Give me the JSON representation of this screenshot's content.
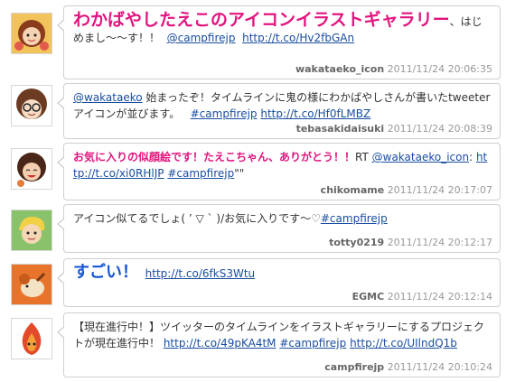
{
  "tweets": [
    {
      "avatar": "girl-with-bow-avatar",
      "lead": "わかばやしたえこのアイコンイラストギャラリー",
      "rest": "、はじめまし〜〜す！！ ",
      "links": [
        "@campfirejp",
        "http://t.co/Hv2fbGAn"
      ],
      "user": "wakataeko_icon",
      "time": "2011/11/24 20:06:35"
    },
    {
      "avatar": "glasses-girl-avatar",
      "mention": "@wakataeko",
      "text": " 始まったぞ！タイムラインに鬼の様にわかばやしさんが書いたtweeterアイコンが並びます。",
      "links": [
        "#campfirejp",
        "http://t.co/Hf0fLMBZ"
      ],
      "user": "tebasakidaisuki",
      "time": "2011/11/24 20:08:39"
    },
    {
      "avatar": "smiling-girl-avatar",
      "pink_text": "お気に入りの似顔絵です！たえこちゃん、ありがとう！！",
      "rt": "RT ",
      "mention": "@wakataeko_icon",
      "colon": ": ",
      "links": [
        "http://t.co/xi0RHlJP",
        "#campfirejp"
      ],
      "tail": "\"\"",
      "user": "chikomame",
      "time": "2011/11/24 20:17:07"
    },
    {
      "avatar": "blond-man-avatar",
      "text": "アイコン似てるでしょ( ’ ▽ ` )/お気に入りです〜♡",
      "links": [
        "#campfirejp"
      ],
      "user": "totty0219",
      "time": "2011/11/24 20:12:17"
    },
    {
      "avatar": "animal-avatar",
      "lead": "すごい！",
      "links": [
        "http://t.co/6fkS3Wtu"
      ],
      "user": "EGMC",
      "time": "2011/11/24 20:12:14"
    },
    {
      "avatar": "campfire-avatar",
      "text": "【現在進行中！】ツイッターのタイムラインをイラストギャラリーにするプロジェクトが現在進行中！ ",
      "links": [
        "http://t.co/49pKA4tM",
        "#campfirejp",
        "http://t.co/UIlndQ1b"
      ],
      "user": "campfirejp",
      "time": "2011/11/24 20:10:24"
    }
  ]
}
